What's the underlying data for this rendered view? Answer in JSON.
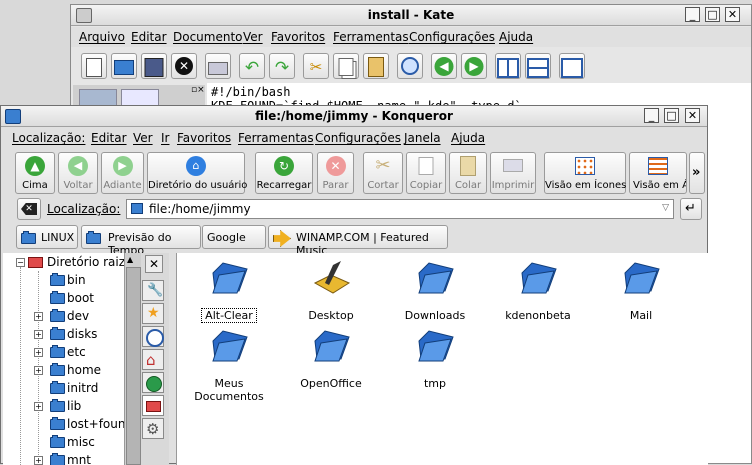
{
  "kate": {
    "title": "install - Kate",
    "menu": [
      "Arquivo",
      "Editar",
      "Documento",
      "Ver",
      "Favoritos",
      "Ferramentas",
      "Configurações",
      "Ajuda"
    ],
    "editor_lines": [
      "#!/bin/bash",
      "KDE_FOUND=`find $HOME -name \".kde\" -type d`"
    ]
  },
  "konq": {
    "title": "file:/home/jimmy - Konqueror",
    "menu": [
      "Localização:",
      "Editar",
      "Ver",
      "Ir",
      "Favoritos",
      "Ferramentas",
      "Configurações",
      "Janela",
      "Ajuda"
    ],
    "toolbar": [
      "Cima",
      "Voltar",
      "Adiante",
      "Diretório do usuário",
      "Recarregar",
      "Parar",
      "Cortar",
      "Copiar",
      "Colar",
      "Imprimir",
      "Visão em Ícones",
      "Visão em Ár"
    ],
    "more_glyph": "»",
    "location_label": "Localização:",
    "location_value": "file:/home/jimmy",
    "bookmarks": [
      "LINUX",
      "Previsão do Tempo",
      "Google",
      "WINAMP.COM | Featured Music"
    ],
    "tree_root": "Diretório raiz",
    "tree": [
      "bin",
      "boot",
      "dev",
      "disks",
      "etc",
      "home",
      "initrd",
      "lib",
      "lost+found",
      "misc",
      "mnt"
    ],
    "files": [
      "Alt-Clear",
      "Desktop",
      "Downloads",
      "kdenonbeta",
      "Mail",
      "Meus Documentos",
      "OpenOffice",
      "tmp"
    ]
  },
  "colors": {
    "folder_blue": "#3a7fd0",
    "selection_blue": "#2a5ba8",
    "green_arrow": "#3aa53a",
    "red_stop": "#d83a3a"
  }
}
